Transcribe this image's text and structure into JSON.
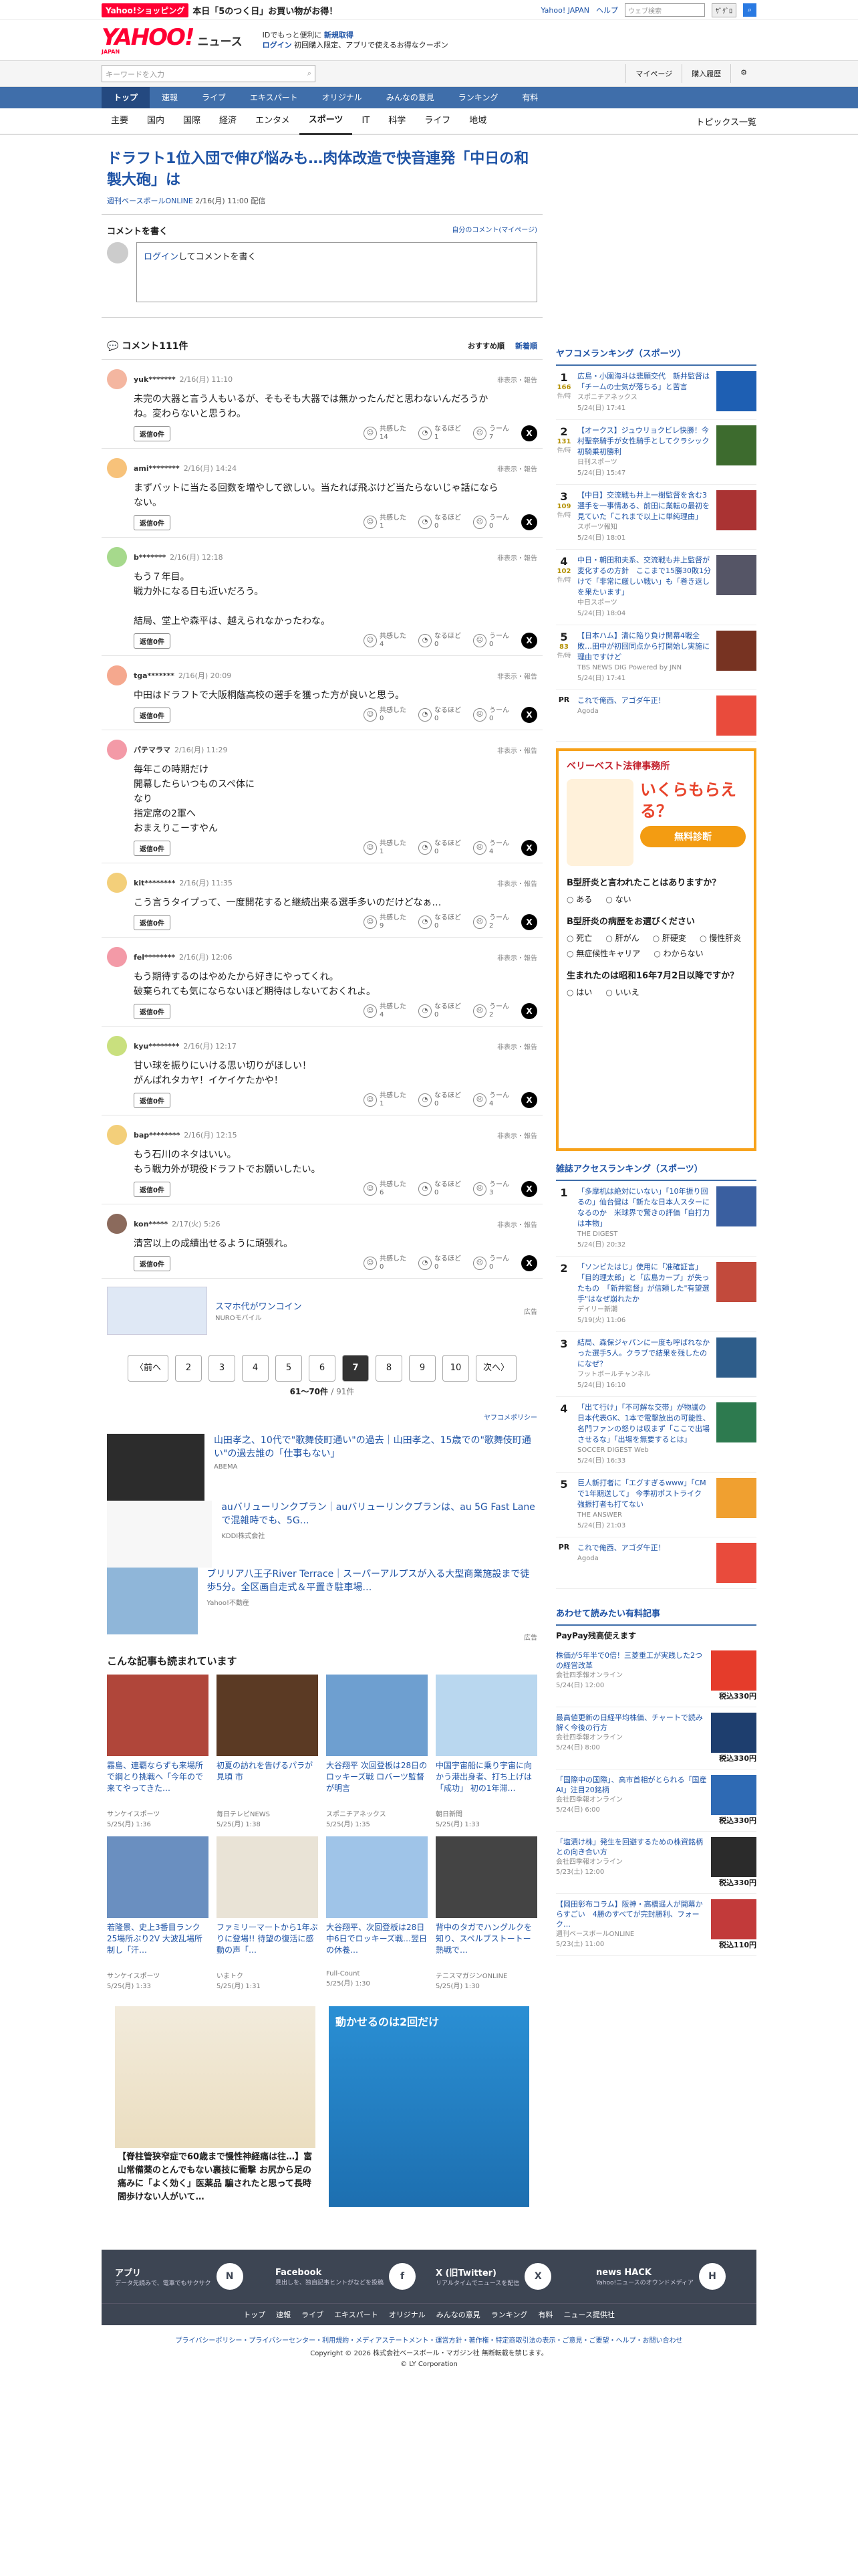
{
  "promo": {
    "badge": "Yahoo!ショッピング",
    "text": "本日「5のつく日」お買い物がお得！",
    "links": [
      "Yahoo! JAPAN",
      "ヘルプ"
    ],
    "search_placeholder": "ウェブ検索",
    "search_btn": "検索",
    "sub": "ｻﾞｸﾞﾛ"
  },
  "logo": {
    "main": "YAHOO!",
    "sub": "JAPAN",
    "service": "ニュース",
    "login1": "IDでもっと便利に",
    "login1b": "新規取得",
    "login2": "ログイン",
    "login3": "初回購入限定、アプリで使えるお得なクーポン"
  },
  "search": {
    "placeholder": "キーワードを入力",
    "mypage": "マイページ",
    "history": "購入履歴"
  },
  "nav": [
    "トップ",
    "速報",
    "ライブ",
    "エキスパート",
    "オリジナル",
    "みんなの意見",
    "ランキング",
    "有料"
  ],
  "subnav": [
    "主要",
    "国内",
    "国際",
    "経済",
    "エンタメ",
    "スポーツ",
    "IT",
    "科学",
    "ライフ",
    "地域"
  ],
  "subnav_right": "トピックス一覧",
  "article": {
    "title": "ドラフト1位入団で伸び悩みも…肉体改造で快音連発「中日の和製大砲」は",
    "source": "週刊ベースボールONLINE",
    "date": "2/16(月) 11:00 配信"
  },
  "comment_write": {
    "label": "コメントを書く",
    "my": "自分のコメント(マイページ)",
    "login": "ログイン",
    "placeholder": "してコメントを書く"
  },
  "comments_header": {
    "title": "コメント111件",
    "sort1": "おすすめ順",
    "sort2": "新着順"
  },
  "reply_label": "返信0件",
  "report_label": "非表示・報告",
  "react_labels": [
    "共感した",
    "なるほど",
    "うーん"
  ],
  "comments": [
    {
      "user": "yuk*******",
      "time": "2/16(月) 11:10",
      "body": "未完の大器と言う人もいるが、そもそも大器では無かったんだと思わないんだろうか\nね。変わらないと思うわ。",
      "r": [
        "14",
        "1",
        "7"
      ],
      "color": "#f4b6a0"
    },
    {
      "user": "ami********",
      "time": "2/16(月) 14:24",
      "body": "まずバットに当たる回数を増やして欲しい。当たれば飛ぶけど当たらないじゃ話になら\nない。",
      "r": [
        "1",
        "0",
        "0"
      ],
      "color": "#f7c27a"
    },
    {
      "user": "b*******",
      "time": "2/16(月) 12:18",
      "body": "もう７年目。\n戦力外になる日も近いだろう。\n\n結局、堂上や森平は、越えられなかったわな。",
      "r": [
        "4",
        "0",
        "0"
      ],
      "color": "#a6d98c"
    },
    {
      "user": "tga*******",
      "time": "2/16(月) 20:09",
      "body": "中田はドラフトで大阪桐蔭高校の選手を獲った方が良いと思う。",
      "r": [
        "0",
        "0",
        "0"
      ],
      "color": "#f5a88e"
    },
    {
      "user": "パテマラマ",
      "time": "2/16(月) 11:29",
      "body": "毎年この時期だけ\n開幕したらいつものスペ体に\nなり\n指定席の2軍へ\nおまえりこーすやん",
      "r": [
        "1",
        "0",
        "4"
      ],
      "color": "#f39aa7"
    },
    {
      "user": "kit********",
      "time": "2/16(月) 11:35",
      "body": "こう言うタイプって、一度開花すると継続出来る選手多いのだけどなぁ…",
      "r": [
        "9",
        "0",
        "2"
      ],
      "color": "#f3cf7a"
    },
    {
      "user": "fel********",
      "time": "2/16(月) 12:06",
      "body": "もう期待するのはやめたから好きにやってくれ。\n破棄られても気にならないほど期待はしないておくれよ。",
      "r": [
        "4",
        "0",
        "2"
      ],
      "color": "#f39aa7"
    },
    {
      "user": "kyu********",
      "time": "2/16(月) 12:17",
      "body": "甘い球を振りにいける思い切りがほしい！\nがんばれタカヤ！イケイケたかや！",
      "r": [
        "1",
        "0",
        "4"
      ],
      "color": "#c9e07e"
    },
    {
      "user": "bap********",
      "time": "2/16(月) 12:15",
      "body": "もう石川のネタはいい。\nもう戦力外が現役ドラフトでお願いしたい。",
      "r": [
        "6",
        "0",
        "3"
      ],
      "color": "#f3cf7a"
    },
    {
      "user": "kon*****",
      "time": "2/17(火) 5:26",
      "body": "清宮以上の成績出せるように頑張れ。",
      "r": [
        "0",
        "0",
        "0"
      ],
      "color": "#8b6a5c"
    }
  ],
  "ad1": {
    "title": "スマホ代がワンコイン",
    "sub": "NUROモバイル",
    "badge": "広告"
  },
  "pager": {
    "prev": "〈前へ",
    "next": "次へ〉",
    "pages": [
      "2",
      "3",
      "4",
      "5",
      "6",
      "7",
      "8",
      "9",
      "10"
    ],
    "current": "7",
    "count": "61〜70件",
    "total": "/ 91件"
  },
  "ymore": "ヤフコメポリシー",
  "ads2": [
    {
      "title": "山田孝之、10代で\"歌舞伎町通い\"の過去｜山田孝之、15歳での\"歌舞伎町通い\"の過去誰の「仕事もない」",
      "src": "ABEMA"
    },
    {
      "title": "auバリューリンクプラン｜auバリューリンクプランは、au 5G Fast Laneで混雑時でも、5G…",
      "src": "KDDI株式会社"
    },
    {
      "title": "ブリリア八王子River Terrace｜スーパーアルプスが入る大型商業施設まで徒歩5分。全区画自走式＆平置き駐車場…",
      "src": "Yahoo!不動産"
    }
  ],
  "ad_tag": "広告",
  "read_title": "こんな記事も読まれています",
  "read": [
    {
      "t": "霧島、連覇ならずも来場所で綱とり挑戦へ「今年ので来てやってきた…",
      "s": "サンケイスポーツ",
      "d": "5/25(月) 1:36"
    },
    {
      "t": "初夏の訪れを告げるパラが見頃 市",
      "s": "毎日テレビNEWS",
      "d": "5/25(月) 1:38"
    },
    {
      "t": "大谷翔平 次回登板は28日の ロッキーズ戦 ロバーツ監督が明言",
      "s": "スポニチアネックス",
      "d": "5/25(月) 1:35"
    },
    {
      "t": "中国宇宙船に乗り宇宙に向かう港出身者、打ち上げは「成功」 初の1年滞…",
      "s": "朝日新聞",
      "d": "5/25(月) 1:33"
    },
    {
      "t": "若隆景、史上3番目ランク25場所ぶり2V 大波乱場所制し「汗…",
      "s": "サンケイスポーツ",
      "d": "5/25(月) 1:33"
    },
    {
      "t": "ファミリーマートから1年ぶりに登場!! 待望の復活に感動の声「…",
      "s": "いまトク",
      "d": "5/25(月) 1:31"
    },
    {
      "t": "大谷翔平、次回登板は28日 中6日でロッキーズ戦…翌日の休養…",
      "s": "Full-Count",
      "d": "5/25(月) 1:30"
    },
    {
      "t": "背中のタガでハングルクを知り、スペルブストートー熱戦で…",
      "s": "テニスマガジンONLINE",
      "d": "5/25(月) 1:30"
    }
  ],
  "bigad": {
    "title": "【脊柱管狭窄症で60歳まで慢性神経痛は往…】富山常備薬のとんでもない裏技に衝撃 お尻から足の痛みに「よく効く」医薬品 騙されたと思って長時間歩けない人がいて…",
    "game": "動かせるのは2回だけ"
  },
  "ranking": {
    "title": "ヤフコメランキング（スポーツ）",
    "items": [
      {
        "t": "広島・小園海斗は悲願交代　新井監督は「チームの士気が落ちる」と苦言",
        "src": "スポニチアネックス",
        "d": "5/24(日) 17:41",
        "c": "166",
        "u": "件/時"
      },
      {
        "t": "【オークス】ジュウリョクビレ快勝！今村聖奈騎手が女性騎手としてクラシック初騎乗初勝利",
        "src": "日刊スポーツ",
        "d": "5/24(日) 15:47",
        "c": "131",
        "u": "件/時"
      },
      {
        "t": "【中日】交流戦も井上一樹監督を含む3選手を一事情ある、前田に業転の最初を見ていた「これまで以上に単純理由」",
        "src": "スポーツ報知",
        "d": "5/24(日) 18:01",
        "c": "109",
        "u": "件/時"
      },
      {
        "t": "中日・朝田和夫系、交流戦も井上監督が変化するの方針　ここまで15勝30敗1分けで「非常に厳しい戦い」も「巻き返しを果たいます」",
        "src": "中日スポーツ",
        "d": "5/24(日) 18:04",
        "c": "102",
        "u": "件/時"
      },
      {
        "t": "【日本ハム】清に陥り負け開幕4戦全敗…田中が初回同点から打開始し実施に理由ですけど",
        "src": "TBS NEWS DIG Powered by JNN",
        "d": "5/24(日) 17:41",
        "c": "83",
        "u": "件/時"
      }
    ],
    "pr": "これで俺西、アゴダ午正！",
    "prsrc": "Agoda"
  },
  "quiz": {
    "head": "ベリーベスト法律事務所",
    "big": "いくらもらえる？",
    "btn": "無料診断",
    "q1": "B型肝炎と言われたことはありますか？",
    "o1": [
      "ある",
      "ない"
    ],
    "q2": "B型肝炎の病歴をお選びください",
    "o2": [
      "死亡",
      "肝がん",
      "肝硬変",
      "慢性肝炎",
      "無症候性キャリア",
      "わからない"
    ],
    "q3": "生まれたのは昭和16年7月2日以降ですか？",
    "o3": [
      "はい",
      "いいえ"
    ]
  },
  "access": {
    "title": "雑誌アクセスランキング（スポーツ）",
    "items": [
      {
        "t": "「多摩机は絶対にいない」「10年振り回るの」仙台健は「新たな日本人スターになるのか　米球界で驚きの評価「自打力は本物」",
        "src": "THE DIGEST",
        "d": "5/24(日) 20:32"
      },
      {
        "t": "「ソンビたはじ」使用に「准確証言」「目的理太郎」と「広島カープ」が失ったもの　「新井監督」が信頼した\"有望選手\"はなぜ崩れたか",
        "src": "デイリー新潮",
        "d": "5/19(火) 11:06"
      },
      {
        "t": "結局、森保ジャパンに一度も呼ばれなかった選手5人。クラブで結果を残したのになぜ？",
        "src": "フットボールチャンネル",
        "d": "5/24(日) 16:10"
      },
      {
        "t": "「出て行け」「不可解な交帯」が物議の日本代表GK、1本で電擊放出の可能性、名門ファンの怒りは収まず「ここで出場させるな」「出場を無要するとは」",
        "src": "SOCCER DIGEST Web",
        "d": "5/24(日) 16:33"
      },
      {
        "t": "巨人新打者に「エグすぎるwww」「CMで1年期送して」 今季初ポストライク　強振打者も打てない",
        "src": "THE ANSWER",
        "d": "5/24(日) 21:03"
      }
    ],
    "pr": "これで俺西、アゴダ午正！",
    "prsrc": "Agoda"
  },
  "paid": {
    "title": "あわせて読みたい有料記事",
    "badge": "PayPay残高使えます",
    "items": [
      {
        "t": "株価が5年半で0倍！三菱重工が実践した2つの経営改革",
        "src": "会社四季報オンライン",
        "d": "5/24(日) 12:00",
        "p": "税込330円"
      },
      {
        "t": "最高値更新の日経平均株価、チャートで読み解く今後の行方",
        "src": "会社四季報オンライン",
        "d": "5/24(日) 8:00",
        "p": "税込330円"
      },
      {
        "t": "「国際中の国際」、高市首相がとられる「国産AI」注目20銘柄",
        "src": "会社四季報オンライン",
        "d": "5/24(日) 6:00",
        "p": "税込330円"
      },
      {
        "t": "「塩漬け株」発生を回避するための株資銘柄との向き合い方",
        "src": "会社四季報オンライン",
        "d": "5/23(土) 12:00",
        "p": "税込330円"
      },
      {
        "t": "【岡田彰布コラム】阪神・高橋遥人が開幕からすごい　4勝のすべてが完封勝利、フォーク…",
        "src": "週刊ベースボールONLINE",
        "d": "5/23(土) 11:00",
        "p": "税込110円"
      }
    ]
  },
  "footer": {
    "boxes": [
      {
        "t": "アプリ",
        "s": "データ先読みで、電車でもサクサク",
        "i": "N"
      },
      {
        "t": "Facebook",
        "s": "見出しを、独自記事ヒントがなどを投稿",
        "i": "f"
      },
      {
        "t": "X (旧Twitter)",
        "s": "リアルタイムでニュースを配信",
        "i": "X"
      },
      {
        "t": "news HACK",
        "s": "Yahoo!ニュースのオウンドメディア",
        "i": "H"
      }
    ],
    "nav": [
      "トップ",
      "速報",
      "ライブ",
      "エキスパート",
      "オリジナル",
      "みんなの意見",
      "ランキング",
      "有料",
      "ニュース提供社"
    ],
    "links": "プライバシーポリシー・プライバシーセンター・利用規約・メディアステートメント・運営方針・著作権・特定商取引法の表示・ご意見・ご要望・ヘルプ・お問い合わせ",
    "copy1": "Copyright © 2026 株式会社ベースボール・マガジン社 無断転載を禁じます。",
    "copy2": "© LY Corporation"
  }
}
